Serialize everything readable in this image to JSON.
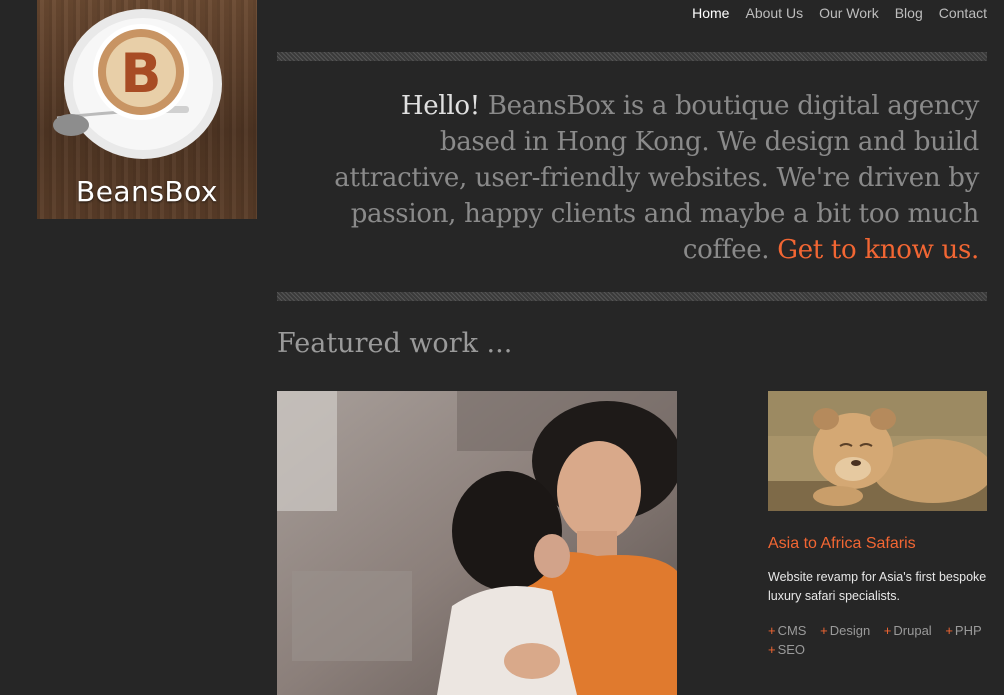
{
  "logo": {
    "text": "BeansBox"
  },
  "nav": [
    {
      "label": "Home",
      "active": true
    },
    {
      "label": "About Us",
      "active": false
    },
    {
      "label": "Our Work",
      "active": false
    },
    {
      "label": "Blog",
      "active": false
    },
    {
      "label": "Contact",
      "active": false
    }
  ],
  "intro": {
    "hello": "Hello!",
    "body": "BeansBox is a boutique digital agency based in Hong Kong. We design and build attractive, user-friendly websites. We're driven by passion, happy clients and maybe a bit too much coffee.",
    "cta": "Get to know us."
  },
  "featured": {
    "heading": "Featured work ...",
    "main_image": "photo-mother-with-baby",
    "thumb_image": "photo-lion-cub",
    "project": {
      "title": "Asia to Africa Safaris",
      "description": "Website revamp for Asia's first bespoke luxury safari specialists.",
      "tags": [
        "CMS",
        "Design",
        "Drupal",
        "PHP",
        "SEO"
      ]
    }
  },
  "colors": {
    "accent": "#f26633",
    "background": "#262626"
  }
}
